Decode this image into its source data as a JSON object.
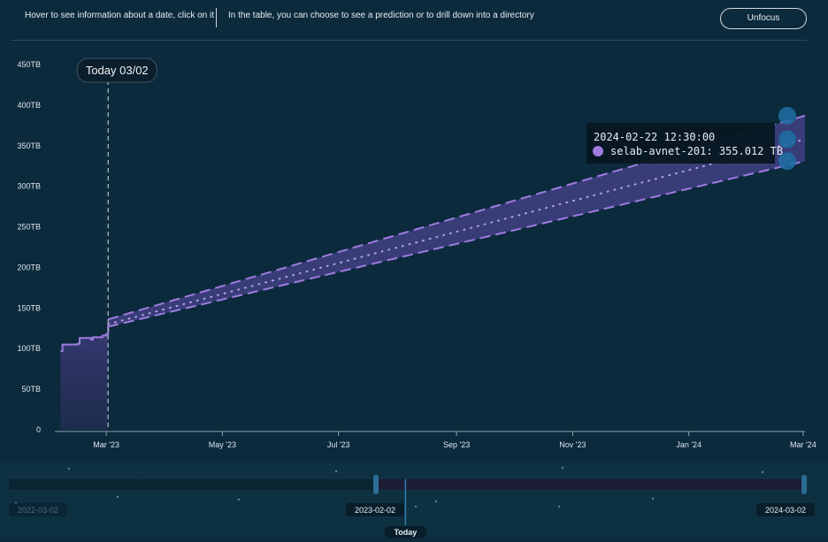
{
  "header": {
    "hint_hover": "Hover to see information about a date, click on it",
    "hint_table": "In the table, you can choose to see a prediction or to drill down into a directory",
    "unfocus_label": "Unfocus"
  },
  "today_marker": {
    "label": "Today 03/02",
    "date": "2023-03-02"
  },
  "tooltip": {
    "timestamp": "2024-02-22 12:30:00",
    "series_line": "selab-avnet-201: 355.012 TB",
    "marker_color": "#9f7be0"
  },
  "colors": {
    "background": "#0b2a3c",
    "series": "#9f7be0",
    "band_fill": "#3d3f7e",
    "history_fill": "#2e2f5d",
    "prediction_endpoint": "#1f6fa3",
    "brush_selection": "#1b1d35",
    "brush_handle": "#2c6d94"
  },
  "chart_data": {
    "type": "area",
    "title": "",
    "xlabel": "",
    "ylabel": "",
    "series_name": "selab-avnet-201",
    "y_unit": "TB",
    "ylim": [
      0,
      450
    ],
    "yticks": [
      "0",
      "50TB",
      "100TB",
      "150TB",
      "200TB",
      "250TB",
      "300TB",
      "350TB",
      "400TB",
      "450TB"
    ],
    "xlim": [
      "2023-02-02",
      "2024-03-02"
    ],
    "xticks": [
      {
        "date": "2023-03-01",
        "label": "Mar '23"
      },
      {
        "date": "2023-05-01",
        "label": "May '23"
      },
      {
        "date": "2023-07-01",
        "label": "Jul '23"
      },
      {
        "date": "2023-09-01",
        "label": "Sep '23"
      },
      {
        "date": "2023-11-01",
        "label": "Nov '23"
      },
      {
        "date": "2024-01-01",
        "label": "Jan '24"
      },
      {
        "date": "2024-03-01",
        "label": "Mar '24"
      }
    ],
    "history": [
      {
        "x": "2023-02-05",
        "y": 97
      },
      {
        "x": "2023-02-06",
        "y": 105
      },
      {
        "x": "2023-02-14",
        "y": 106
      },
      {
        "x": "2023-02-15",
        "y": 113
      },
      {
        "x": "2023-02-20",
        "y": 113
      },
      {
        "x": "2023-02-21",
        "y": 111
      },
      {
        "x": "2023-02-22",
        "y": 114
      },
      {
        "x": "2023-02-26",
        "y": 114
      },
      {
        "x": "2023-02-27",
        "y": 116
      },
      {
        "x": "2023-03-01",
        "y": 118
      },
      {
        "x": "2023-03-02",
        "y": 130
      }
    ],
    "prediction": [
      {
        "x": "2023-03-02",
        "y": 130
      },
      {
        "x": "2024-03-02",
        "y": 358
      }
    ],
    "prediction_upper": [
      {
        "x": "2023-03-02",
        "y": 136
      },
      {
        "x": "2024-03-02",
        "y": 387
      }
    ],
    "prediction_lower": [
      {
        "x": "2023-03-02",
        "y": 127
      },
      {
        "x": "2024-03-02",
        "y": 331
      }
    ],
    "grid": false,
    "legend": "none"
  },
  "brush": {
    "range_start": "2022-03-02",
    "selection_start": "2023-02-02",
    "selection_end": "2024-03-02",
    "today_label": "Today"
  }
}
